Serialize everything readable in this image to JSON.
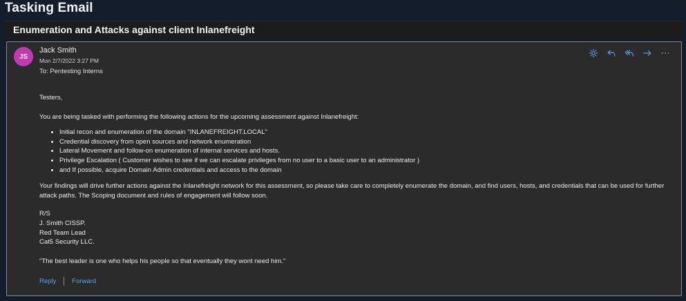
{
  "page": {
    "title": "Tasking Email"
  },
  "email": {
    "subject": "Enumeration and Attacks against client Inlanefreight",
    "sender": {
      "initials": "JS",
      "name": "Jack Smith",
      "date": "Mon 2/7/2022 3:27 PM",
      "avatar_color": "#c239b3"
    },
    "to_line": "To: Pentesting Interns",
    "actions": [
      {
        "name": "sun-icon"
      },
      {
        "name": "reply-icon"
      },
      {
        "name": "reply-all-icon"
      },
      {
        "name": "forward-icon"
      },
      {
        "name": "more-icon"
      }
    ],
    "body": {
      "greeting": "Testers,",
      "intro": "You are being tasked with performing the following actions for the upcoming assessment against Inlanefreight:",
      "tasks": [
        "Initial recon and enumeration of the domain \"INLANEFREIGHT.LOCAL\"",
        "Credential discovery from open sources and network enumeration",
        "Lateral Movement and follow-on enumeration of internal services and hosts.",
        "Privilege Escalation ( Customer wishes to see if we can escalate privileges from no user to a basic user to an administrator )",
        "and If possible, acquire Domain Admin credentials and access to the domain"
      ],
      "findings": "Your findings will drive further actions against the Inlanefreight network for this assessment, so please take care to completely enumerate the domain, and find users, hosts, and credentials that can be used for further attack paths. The Scoping document and rules of engagement will follow soon.",
      "signature": [
        "R/S",
        "J. Smith CISSP.",
        "Red Team Lead",
        "Cat5 Security LLC."
      ],
      "quote": "\"The best leader is one who helps his people so that eventually they wont need him.\""
    },
    "reply_label": "Reply",
    "forward_label": "Forward"
  },
  "colors": {
    "page_bg": "#141d2b",
    "card_bg": "#2b2b2b",
    "link": "#5aa4e8",
    "icon": "#5aa4e8"
  }
}
